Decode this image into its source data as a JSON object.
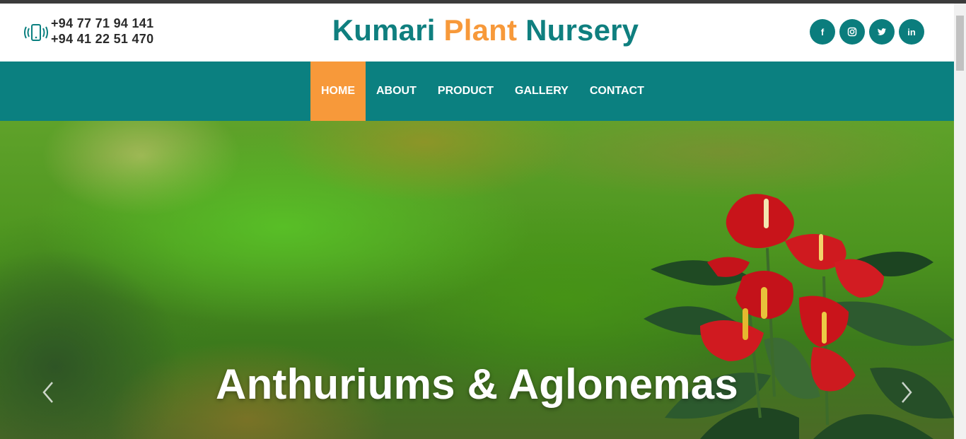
{
  "header": {
    "phones": [
      "+94 77 71 94 141",
      "+94 41 22 51 470"
    ],
    "phone_icon": "phone-vibrate-icon",
    "brand": {
      "part1": "Kumari",
      "part2": "Plant",
      "part3": "Nursery"
    },
    "socials": [
      {
        "name": "facebook",
        "glyph": "f"
      },
      {
        "name": "instagram",
        "glyph": ""
      },
      {
        "name": "twitter",
        "glyph": ""
      },
      {
        "name": "linkedin",
        "glyph": "in"
      }
    ]
  },
  "nav": {
    "items": [
      {
        "label": "HOME",
        "active": true
      },
      {
        "label": "ABOUT",
        "active": false
      },
      {
        "label": "PRODUCT",
        "active": false
      },
      {
        "label": "GALLERY",
        "active": false
      },
      {
        "label": "CONTACT",
        "active": false
      }
    ]
  },
  "hero": {
    "caption": "Anthuriums & Aglonemas",
    "prev_icon": "chevron-left-icon",
    "next_icon": "chevron-right-icon"
  },
  "colors": {
    "teal": "#0b8080",
    "orange": "#f7993a",
    "brand_teal": "#0f7f7f"
  }
}
